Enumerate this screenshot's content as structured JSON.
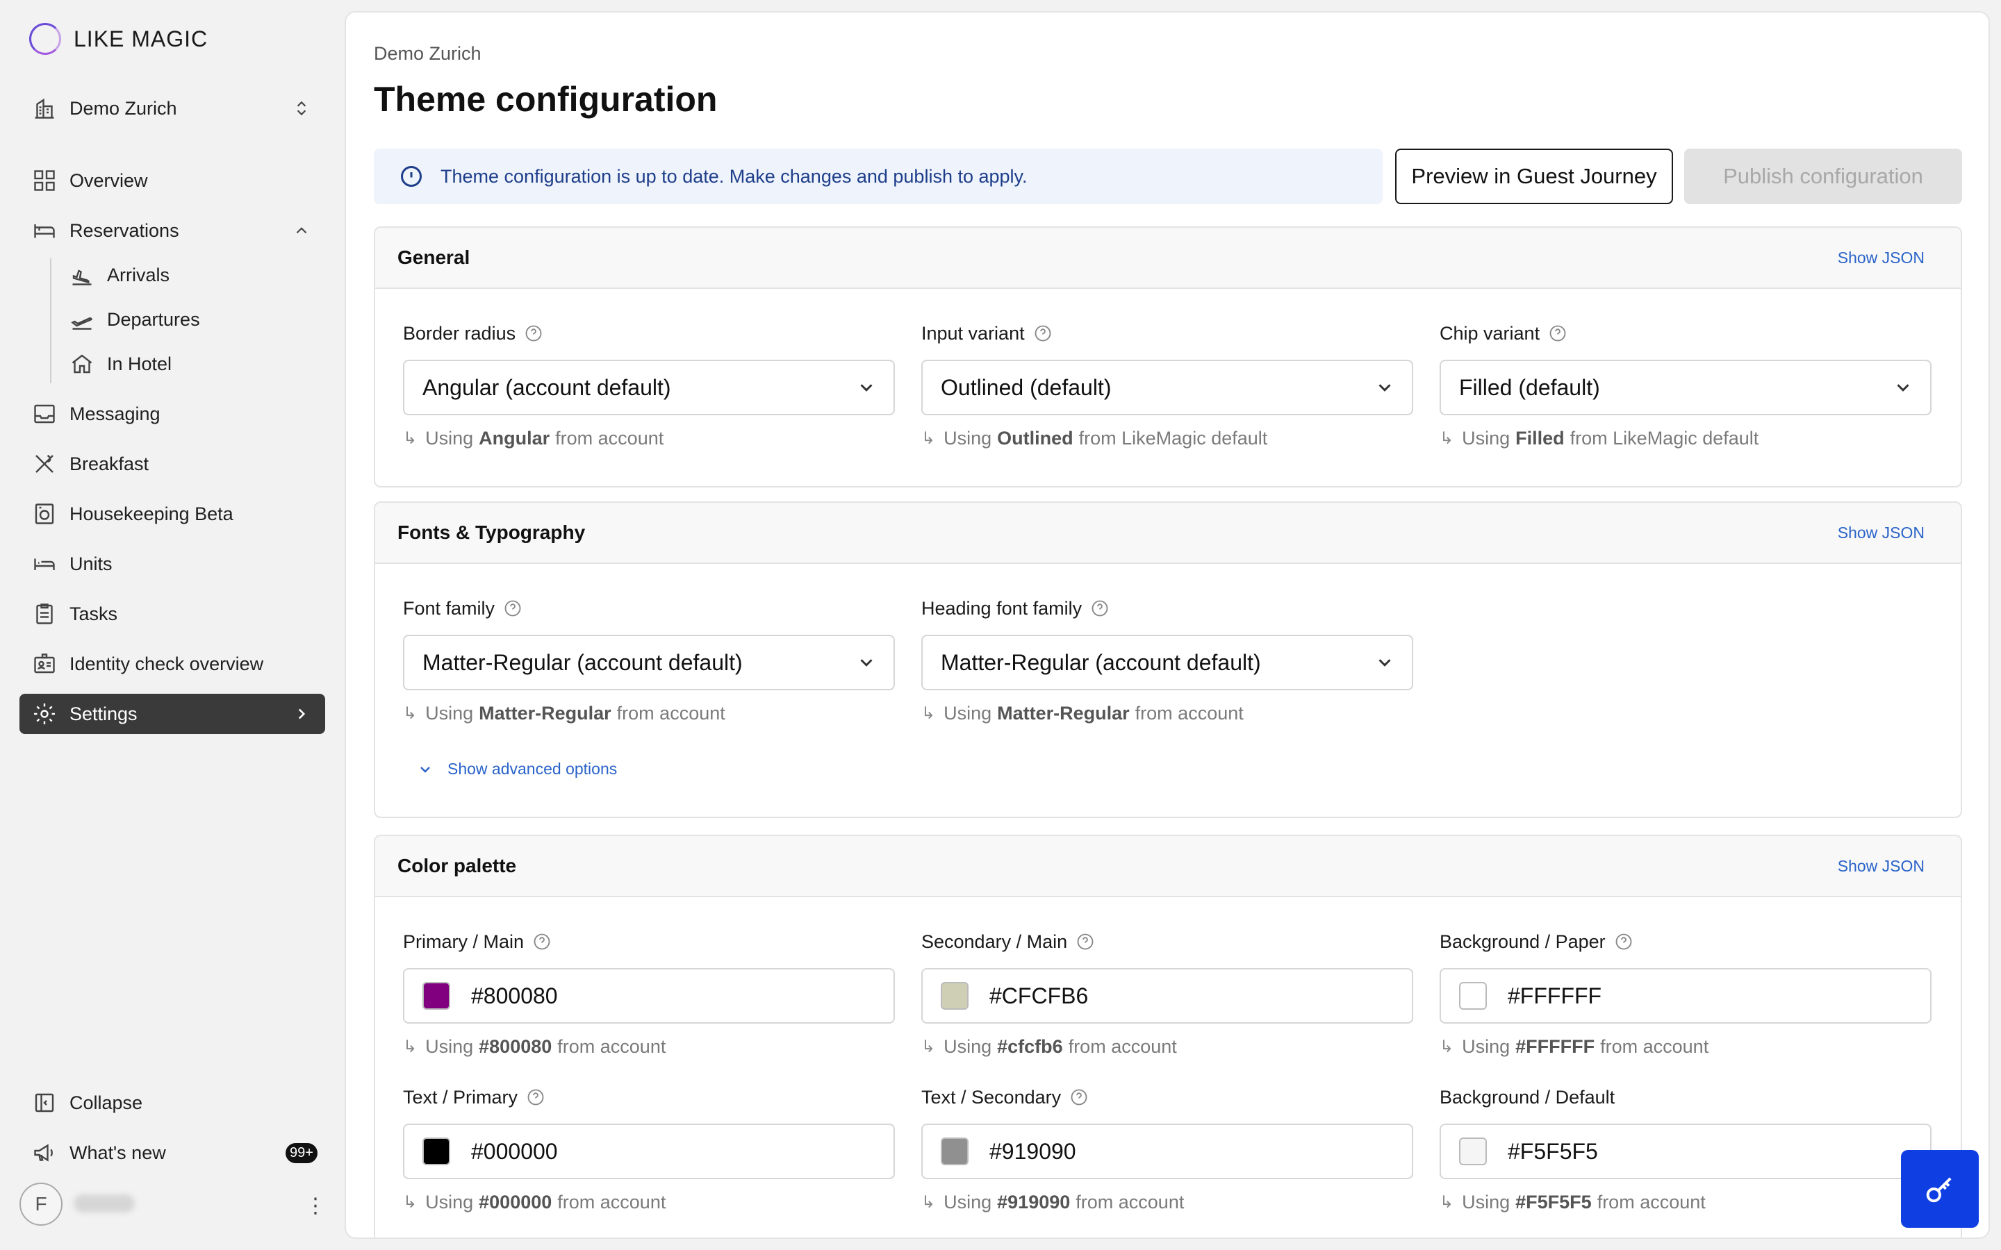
{
  "brand": {
    "name": "LIKE MAGIC"
  },
  "sidebar": {
    "property": "Demo Zurich",
    "items": {
      "overview": "Overview",
      "reservations": "Reservations",
      "arrivals": "Arrivals",
      "departures": "Departures",
      "in_hotel": "In Hotel",
      "messaging": "Messaging",
      "breakfast": "Breakfast",
      "housekeeping": "Housekeeping Beta",
      "units": "Units",
      "tasks": "Tasks",
      "identity": "Identity check overview",
      "settings": "Settings"
    },
    "collapse": "Collapse",
    "whats_new": "What's new",
    "whats_new_badge": "99+",
    "avatar_initial": "F"
  },
  "header": {
    "breadcrumb": "Demo Zurich",
    "title": "Theme configuration",
    "alert": "Theme configuration is up to date. Make changes and publish to apply.",
    "preview_btn": "Preview in Guest Journey",
    "publish_btn": "Publish configuration"
  },
  "general": {
    "title": "General",
    "show_json": "Show JSON",
    "border_radius": {
      "label": "Border radius",
      "value": "Angular (account default)",
      "hint_pre": "Using",
      "hint_val": "Angular",
      "hint_post": "from account"
    },
    "input_variant": {
      "label": "Input variant",
      "value": "Outlined (default)",
      "hint_pre": "Using",
      "hint_val": "Outlined",
      "hint_post": "from LikeMagic default"
    },
    "chip_variant": {
      "label": "Chip variant",
      "value": "Filled (default)",
      "hint_pre": "Using",
      "hint_val": "Filled",
      "hint_post": "from LikeMagic default"
    }
  },
  "fonts": {
    "title": "Fonts & Typography",
    "show_json": "Show JSON",
    "font_family": {
      "label": "Font family",
      "value": "Matter-Regular (account default)",
      "hint_pre": "Using",
      "hint_val": "Matter-Regular",
      "hint_post": "from account"
    },
    "heading_font": {
      "label": "Heading font family",
      "value": "Matter-Regular (account default)",
      "hint_pre": "Using",
      "hint_val": "Matter-Regular",
      "hint_post": "from account"
    },
    "advanced": "Show advanced options"
  },
  "palette": {
    "title": "Color palette",
    "show_json": "Show JSON",
    "primary_main": {
      "label": "Primary / Main",
      "value": "#800080",
      "hint_pre": "Using",
      "hint_val": "#800080",
      "hint_post": "from account",
      "swatch": "#800080"
    },
    "secondary_main": {
      "label": "Secondary / Main",
      "value": "#CFCFB6",
      "hint_pre": "Using",
      "hint_val": "#cfcfb6",
      "hint_post": "from account",
      "swatch": "#CFCFB6"
    },
    "bg_paper": {
      "label": "Background / Paper",
      "value": "#FFFFFF",
      "hint_pre": "Using",
      "hint_val": "#FFFFFF",
      "hint_post": "from account",
      "swatch": "#FFFFFF"
    },
    "text_primary": {
      "label": "Text / Primary",
      "value": "#000000",
      "hint_pre": "Using",
      "hint_val": "#000000",
      "hint_post": "from account",
      "swatch": "#000000"
    },
    "text_secondary": {
      "label": "Text / Secondary",
      "value": "#919090",
      "hint_pre": "Using",
      "hint_val": "#919090",
      "hint_post": "from account",
      "swatch": "#919090"
    },
    "bg_default": {
      "label": "Background / Default",
      "value": "#F5F5F5",
      "hint_pre": "Using",
      "hint_val": "#F5F5F5",
      "hint_post": "from account",
      "swatch": "#F5F5F5"
    }
  },
  "colors": {
    "accent": "#2a63c9",
    "fab": "#0f3ee3",
    "active_nav": "#3a3a3a"
  },
  "icons": [
    "logo-ring-icon",
    "building-icon",
    "grid-icon",
    "bed-icon",
    "plane-land-icon",
    "plane-takeoff-icon",
    "home-icon",
    "inbox-icon",
    "utensils-icon",
    "washer-icon",
    "bed-unit-icon",
    "clipboard-icon",
    "id-card-icon",
    "gear-icon",
    "sidebar-collapse-icon",
    "megaphone-icon",
    "info-icon",
    "help-icon",
    "chevron-down-icon",
    "key-icon"
  ]
}
